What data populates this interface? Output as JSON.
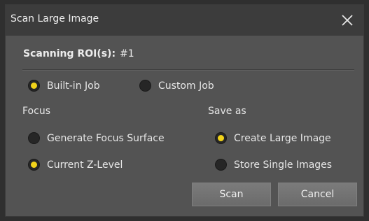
{
  "dialog": {
    "title": "Scan Large Image",
    "close_icon": "close-icon"
  },
  "roi": {
    "label": "Scanning ROI(s):",
    "value": "#1"
  },
  "job": {
    "options": [
      {
        "label": "Built-in Job",
        "checked": true
      },
      {
        "label": "Custom Job",
        "checked": false
      }
    ]
  },
  "focus": {
    "label": "Focus",
    "options": [
      {
        "label": "Generate Focus Surface",
        "checked": false
      },
      {
        "label": "Current Z-Level",
        "checked": true
      }
    ]
  },
  "save_as": {
    "label": "Save as",
    "options": [
      {
        "label": "Create Large Image",
        "checked": true
      },
      {
        "label": "Store Single Images",
        "checked": false
      }
    ]
  },
  "buttons": {
    "scan": "Scan",
    "cancel": "Cancel"
  },
  "colors": {
    "accent": "#f0d21a",
    "background": "#535353",
    "titlebar": "#3c3c3c"
  }
}
